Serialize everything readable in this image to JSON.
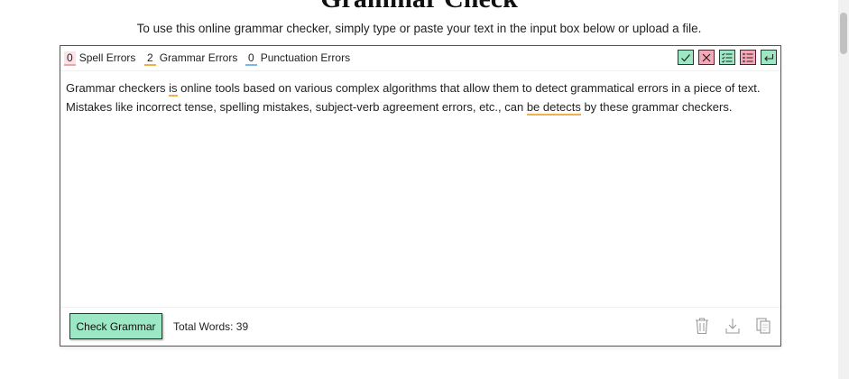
{
  "header": {
    "title": "Grammar Check",
    "subtitle": "To use this online grammar checker, simply type or paste your text in the input box below or upload a file."
  },
  "stats": {
    "spell": {
      "count": "0",
      "label": "Spell Errors"
    },
    "grammar": {
      "count": "2",
      "label": "Grammar Errors"
    },
    "punctuation": {
      "count": "0",
      "label": "Punctuation Errors"
    }
  },
  "tools": {
    "accept_icon": "check-icon",
    "reject_icon": "x-icon",
    "accept_all_icon": "checklist-icon",
    "reject_all_icon": "list-x-icon",
    "undo_icon": "return-arrow-icon"
  },
  "editor": {
    "line1": {
      "before": "Grammar checkers ",
      "error": "is",
      "after": " online tools based on various complex algorithms that allow them to detect grammatical errors in a piece of text."
    },
    "line2": {
      "before": "Mistakes like incorrect tense, spelling mistakes, subject-verb agreement errors, etc., can ",
      "error": "be detects",
      "after": " by these grammar checkers."
    }
  },
  "footer": {
    "check_button": "Check Grammar",
    "total_words": "Total Words: 39",
    "delete_icon": "trash-icon",
    "download_icon": "download-icon",
    "copy_icon": "copy-icon"
  },
  "colors": {
    "check_button_bg": "#9de8c4",
    "accept_bg": "#9de8c4",
    "reject_bg": "#f7a8b8",
    "grammar_underline": "#f0b04a",
    "spell_highlight": "#fde3e6",
    "punctuation_underline": "#7fb7e8"
  }
}
